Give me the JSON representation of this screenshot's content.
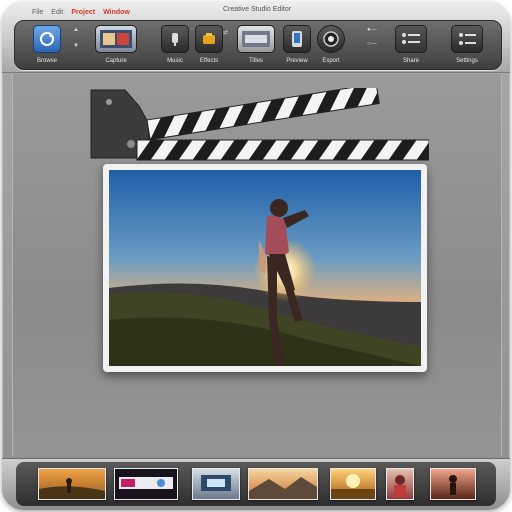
{
  "menu": {
    "item_1": "File",
    "item_2": "Edit",
    "item_3": "Project",
    "item_4": "Window"
  },
  "window": {
    "title": "Creative Studio Editor"
  },
  "toolbar": {
    "tools": [
      {
        "label": "Browse",
        "icon": "refresh-icon"
      },
      {
        "label": "Capture",
        "icon": "camera-icon"
      },
      {
        "label": "Music",
        "icon": "music-icon"
      },
      {
        "label": "Effects",
        "icon": "effects-icon"
      },
      {
        "label": "Titles",
        "icon": "titles-icon"
      },
      {
        "label": "Preview",
        "icon": "preview-icon"
      },
      {
        "label": "Export",
        "icon": "film-icon"
      },
      {
        "label": "Share",
        "icon": "share-icon"
      },
      {
        "label": "Settings",
        "icon": "settings-icon"
      }
    ]
  },
  "colors": {
    "accent": "#2b64b3",
    "sky_top": "#1f5fa8",
    "sunset": "#f08a2a"
  },
  "filmstrip": {
    "thumbs": [
      {
        "name": "thumb-sunset-runner"
      },
      {
        "name": "thumb-night-city"
      },
      {
        "name": "thumb-stage-lights"
      },
      {
        "name": "thumb-mountain-valley"
      },
      {
        "name": "thumb-golden-field"
      },
      {
        "name": "thumb-portrait"
      },
      {
        "name": "thumb-dancer"
      }
    ]
  }
}
